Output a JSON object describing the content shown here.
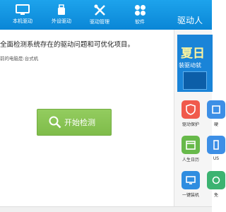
{
  "nav": [
    {
      "label": "本机驱动",
      "icon": "monitor-icon"
    },
    {
      "label": "外设驱动",
      "icon": "usb-icon"
    },
    {
      "label": "驱动管理",
      "icon": "tools-icon"
    },
    {
      "label": "软件",
      "icon": "apps-icon"
    }
  ],
  "brand": "驱动人",
  "main": {
    "description": "全面检测系统存在的驱动问题和可优化项目。",
    "pc_info": "前的电脑是:台式机",
    "start_button": "开始检测"
  },
  "side": {
    "banner_title": "夏日",
    "banner_sub": "装驱动就",
    "tiles": [
      {
        "label": "驱动保护",
        "icon": "shield-icon",
        "color": "#f05a4c"
      },
      {
        "label": "硬",
        "icon": "hardware-icon",
        "color": "#3d8fe6"
      },
      {
        "label": "人生日历",
        "icon": "calendar-icon",
        "color": "#67b94a"
      },
      {
        "label": "US",
        "icon": "usb-tool-icon",
        "color": "#3d8fe6"
      },
      {
        "label": "一键装机",
        "icon": "install-icon",
        "color": "#2f8de0"
      },
      {
        "label": "免",
        "icon": "free-icon",
        "color": "#3cb371"
      }
    ]
  },
  "colors": {
    "top_bar": "#0a86d6",
    "start_button": "#7fbc4a"
  }
}
